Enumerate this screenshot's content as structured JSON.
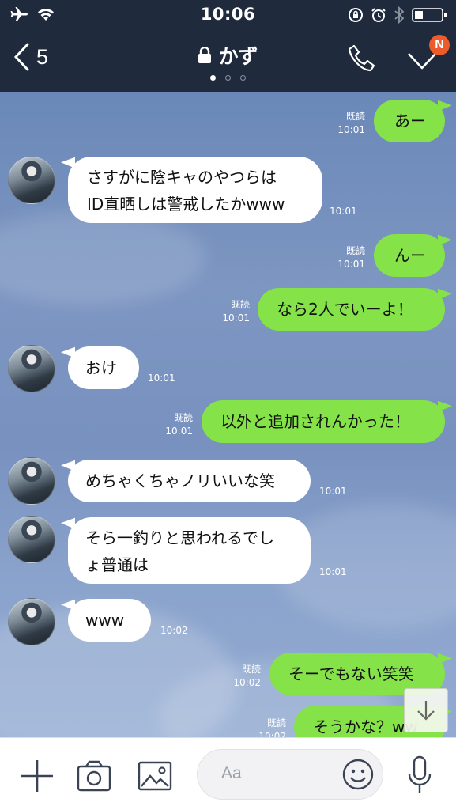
{
  "status_bar": {
    "time": "10:06"
  },
  "nav": {
    "back_count": "5",
    "title": "かず",
    "badge": "N"
  },
  "messages": [
    {
      "side": "right",
      "text_lines": [
        "あー"
      ],
      "read": "既読",
      "time": "10:01"
    },
    {
      "side": "left",
      "text_lines": [
        "さすがに陰キャのやつらは",
        "ID直晒しは警戒したかwww"
      ],
      "time": "10:01"
    },
    {
      "side": "right",
      "text_lines": [
        "んー"
      ],
      "read": "既読",
      "time": "10:01"
    },
    {
      "side": "right",
      "text_lines": [
        "なら2人でいーよ！"
      ],
      "read": "既読",
      "time": "10:01"
    },
    {
      "side": "left",
      "text_lines": [
        "おけ"
      ],
      "time": "10:01"
    },
    {
      "side": "right",
      "text_lines": [
        "以外と追加されんかった！"
      ],
      "read": "既読",
      "time": "10:01"
    },
    {
      "side": "left",
      "text_lines": [
        "めちゃくちゃノリいいな笑"
      ],
      "time": "10:01"
    },
    {
      "side": "left",
      "text_lines": [
        "そら一釣りと思われるでし",
        "ょ普通は"
      ],
      "time": "10:01"
    },
    {
      "side": "left",
      "text_lines": [
        "www"
      ],
      "time": "10:02"
    },
    {
      "side": "right",
      "text_lines": [
        "そーでもない笑笑"
      ],
      "read": "既読",
      "time": "10:02"
    },
    {
      "side": "right",
      "text_lines": [
        "そうかな？ww"
      ],
      "read": "既読",
      "time": "10:02"
    }
  ],
  "input": {
    "placeholder": "Aa"
  },
  "colors": {
    "header": "#1f2a3d",
    "sent_bubble": "#85e249",
    "received_bubble": "#ffffff",
    "badge": "#ec5b2c"
  },
  "icons": [
    "airplane-icon",
    "wifi-icon",
    "rotation-lock-icon",
    "alarm-icon",
    "bluetooth-icon",
    "battery-icon",
    "back-chevron-icon",
    "lock-icon",
    "phone-icon",
    "check-icon",
    "arrow-down-icon",
    "plus-icon",
    "camera-icon",
    "image-icon",
    "emoji-icon",
    "microphone-icon"
  ]
}
